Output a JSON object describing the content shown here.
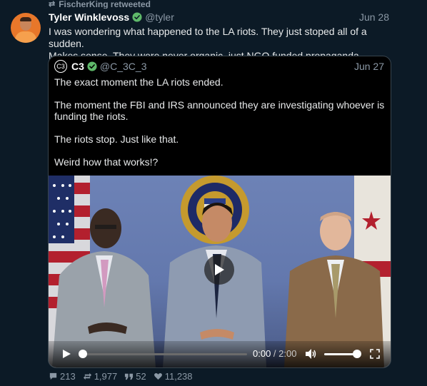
{
  "retweet": {
    "label": "FischerKing retweeted"
  },
  "tweet": {
    "name": "Tyler Winklevoss",
    "handle": "@tyler",
    "date": "Jun 28",
    "text_line1": "I was wondering what happened to the LA riots. They just stoped all of a sudden.",
    "text_line2": "Makes sense. They were never organic, just NGO funded propaganda."
  },
  "quote": {
    "avatar_label": "C3",
    "name": "C3",
    "handle": "@C_3C_3",
    "date": "Jun 27",
    "paragraphs": [
      "The exact moment the LA riots ended.",
      "The moment the FBI and IRS announced they are investigating whoever is funding the riots.",
      "The riots stop. Just like that.",
      "Weird how that works!?"
    ]
  },
  "video": {
    "seal_text": "DEPARTMENT OF JUSTICE · FEDERAL BUREAU OF INVESTIGATION",
    "current_time": "0:00",
    "separator": " / ",
    "duration": "2:00",
    "progress": 0.0,
    "volume": 1.0
  },
  "stats": {
    "replies": "213",
    "retweets": "1,977",
    "quotes": "52",
    "likes": "11,238"
  },
  "colors": {
    "background": "#0c1a26",
    "verified": "#5fb96a",
    "muted": "#8b98a5"
  }
}
